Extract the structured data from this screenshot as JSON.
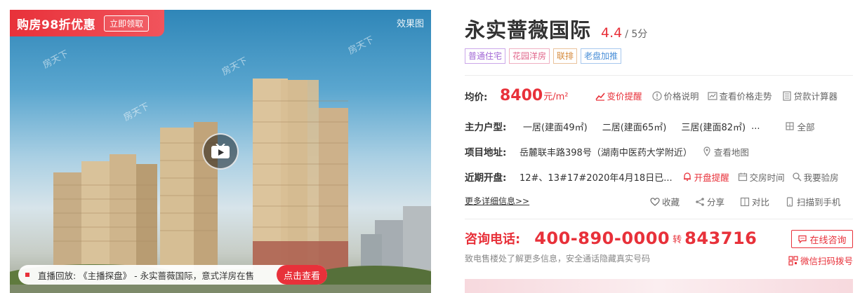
{
  "hero": {
    "promo_text": "购房98折优惠",
    "promo_button": "立即领取",
    "effect_tag": "效果图",
    "watermark": "房天下",
    "live_text": "直播回放: 《主播探盘》 - 永实蔷薇国际，意式洋房在售",
    "live_button": "点击查看",
    "play_icon": "video-play-icon"
  },
  "project": {
    "name": "永实蔷薇国际",
    "score": "4.4",
    "score_max": "/ 5分",
    "tags": [
      {
        "label": "普通住宅",
        "color": "#a36ad6"
      },
      {
        "label": "花园洋房",
        "color": "#e0658a"
      },
      {
        "label": "联排",
        "color": "#d58a3c"
      },
      {
        "label": "老盘加推",
        "color": "#4a8fd8"
      }
    ]
  },
  "price": {
    "label": "均价:",
    "value": "8400",
    "unit": "元/m²",
    "actions": [
      "变价提醒",
      "价格说明",
      "查看价格走势",
      "贷款计算器"
    ]
  },
  "layout": {
    "label": "主力户型:",
    "items": [
      "一居(建面49㎡)",
      "二居(建面65㎡)",
      "三居(建面82㎡)",
      "..."
    ],
    "all": "全部"
  },
  "address": {
    "label": "项目地址:",
    "value": "岳麓联丰路398号（湖南中医药大学附近）",
    "map": "查看地图"
  },
  "opening": {
    "label": "近期开盘:",
    "value": "12#、13#17#2020年4月18日已...",
    "actions": [
      "开盘提醒",
      "交房时间",
      "我要验房"
    ]
  },
  "more": {
    "link": "更多详细信息>>",
    "actions": [
      "收藏",
      "分享",
      "对比",
      "扫描到手机"
    ]
  },
  "contact": {
    "label": "咨询电话:",
    "number": "400-890-0000",
    "zhuan": "转",
    "ext": "843716",
    "note": "致电售楼处了解更多信息，安全通话隐藏真实号码",
    "consult": "在线咨询",
    "scan_dial": "微信扫码拨号"
  },
  "colors": {
    "accent": "#e8313a"
  }
}
